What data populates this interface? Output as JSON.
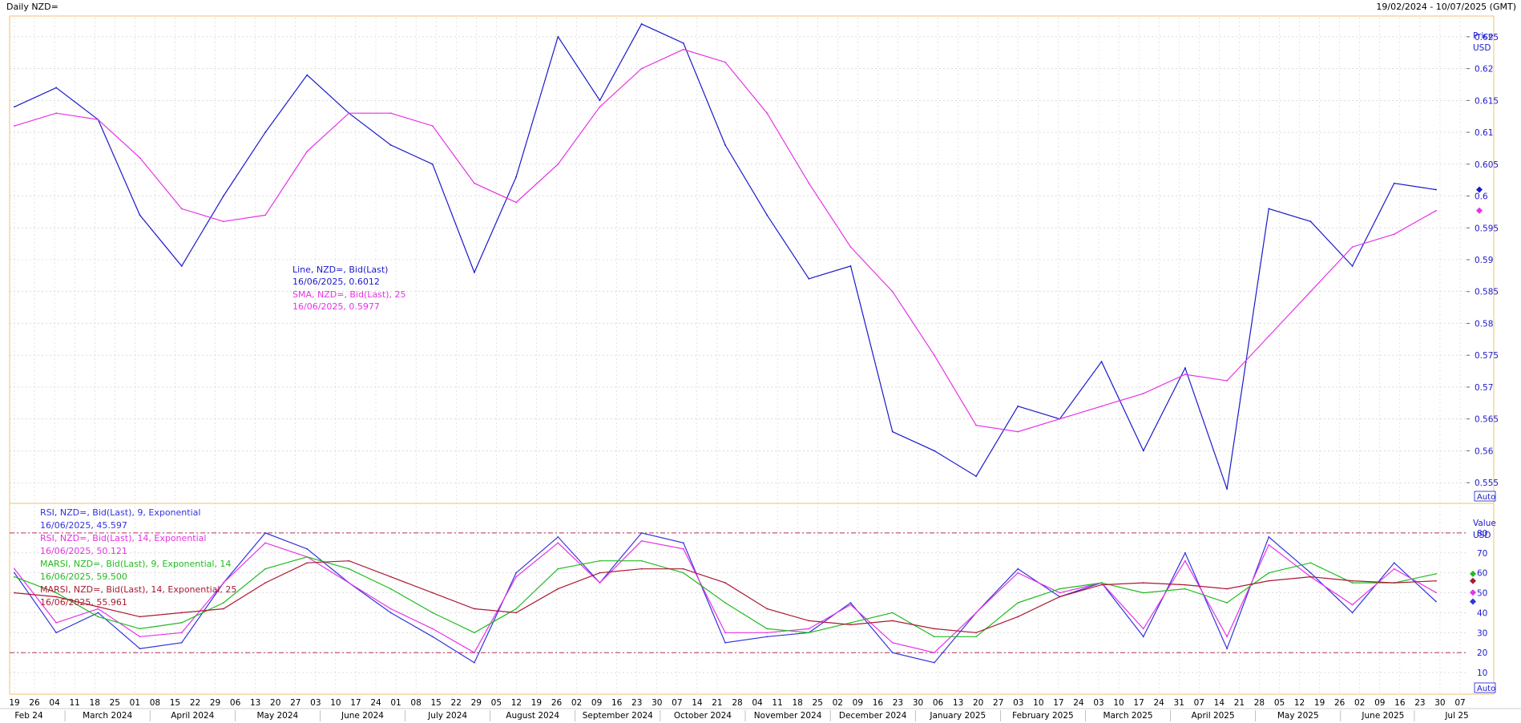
{
  "window": {
    "title": "Daily NZD=",
    "date_range": "19/02/2024 - 10/07/2025 (GMT)"
  },
  "price_panel": {
    "axis_title": "Price",
    "axis_unit": "USD",
    "auto_label": "Auto",
    "ticks": [
      "0.625",
      "0.62",
      "0.615",
      "0.61",
      "0.605",
      "0.6",
      "0.595",
      "0.59",
      "0.585",
      "0.58",
      "0.575",
      "0.57",
      "0.565",
      "0.56",
      "0.555"
    ],
    "legend": {
      "line_label": "Line, NZD=, Bid(Last)",
      "line_value": "16/06/2025, 0.6012",
      "sma_label": "SMA, NZD=, Bid(Last), 25",
      "sma_value": "16/06/2025, 0.5977"
    }
  },
  "osc_panel": {
    "axis_title": "Value",
    "axis_unit": "USD",
    "auto_label": "Auto",
    "ticks": [
      "80",
      "70",
      "60",
      "50",
      "40",
      "30",
      "20",
      "10"
    ],
    "legend": {
      "rsi9_label": "RSI, NZD=, Bid(Last), 9, Exponential",
      "rsi9_value": "16/06/2025, 45.597",
      "rsi14_label": "RSI, NZD=, Bid(Last), 14, Exponential",
      "rsi14_value": "16/06/2025, 50.121",
      "marsi9_label": "MARSI, NZD=, Bid(Last), 9, Exponential, 14",
      "marsi9_value": "16/06/2025, 59.500",
      "marsi14_label": "MARSI, NZD=, Bid(Last), 14, Exponential, 25",
      "marsi14_value": "16/06/2025, 55.961"
    }
  },
  "x_axis": {
    "day_ticks": [
      "19",
      "26",
      "04",
      "11",
      "18",
      "25",
      "01",
      "08",
      "15",
      "22",
      "29",
      "06",
      "13",
      "20",
      "27",
      "03",
      "10",
      "17",
      "24",
      "01",
      "08",
      "15",
      "22",
      "29",
      "05",
      "12",
      "19",
      "26",
      "02",
      "09",
      "16",
      "23",
      "30",
      "07",
      "14",
      "21",
      "28",
      "04",
      "11",
      "18",
      "25",
      "02",
      "09",
      "16",
      "23",
      "30",
      "06",
      "13",
      "20",
      "27",
      "03",
      "10",
      "17",
      "24",
      "03",
      "10",
      "17",
      "24",
      "31",
      "07",
      "14",
      "21",
      "28",
      "05",
      "12",
      "19",
      "26",
      "02",
      "09",
      "16",
      "23",
      "30",
      "07"
    ],
    "month_labels": [
      "Feb 24",
      "March 2024",
      "April 2024",
      "May 2024",
      "June 2024",
      "July 2024",
      "August 2024",
      "September 2024",
      "October 2024",
      "November 2024",
      "December 2024",
      "January 2025",
      "February 2025",
      "March 2025",
      "April 2025",
      "May 2025",
      "June 2025",
      "Jul 25"
    ]
  },
  "colors": {
    "price_line": "#1a1acc",
    "sma_line": "#e633e6",
    "rsi9": "#3333dd",
    "rsi14": "#e633e6",
    "marsi9": "#22bb22",
    "marsi14": "#aa1a33",
    "ob_os_line": "#b0305a",
    "panel_border": "#f0c070",
    "grid": "#c8c8c8"
  },
  "chart_data": [
    {
      "type": "line",
      "title": "Daily NZD=",
      "xlabel": "",
      "ylabel": "Price USD",
      "ylim": [
        0.552,
        0.628
      ],
      "x": [
        "2024-02-19",
        "2024-03-04",
        "2024-03-18",
        "2024-04-01",
        "2024-04-15",
        "2024-05-01",
        "2024-05-13",
        "2024-06-01",
        "2024-06-17",
        "2024-07-01",
        "2024-07-15",
        "2024-07-29",
        "2024-08-12",
        "2024-08-26",
        "2024-09-09",
        "2024-09-23",
        "2024-09-30",
        "2024-10-14",
        "2024-10-28",
        "2024-11-11",
        "2024-11-25",
        "2024-12-09",
        "2024-12-23",
        "2025-01-13",
        "2025-01-27",
        "2025-02-10",
        "2025-02-24",
        "2025-03-10",
        "2025-03-24",
        "2025-04-07",
        "2025-04-21",
        "2025-05-05",
        "2025-05-19",
        "2025-06-02",
        "2025-06-16"
      ],
      "series": [
        {
          "name": "Line, NZD=, Bid(Last)",
          "values": [
            0.614,
            0.617,
            0.612,
            0.597,
            0.589,
            0.6,
            0.61,
            0.619,
            0.613,
            0.608,
            0.605,
            0.588,
            0.603,
            0.625,
            0.615,
            0.627,
            0.624,
            0.608,
            0.597,
            0.587,
            0.589,
            0.563,
            0.56,
            0.556,
            0.567,
            0.565,
            0.574,
            0.56,
            0.573,
            0.554,
            0.598,
            0.596,
            0.589,
            0.602,
            0.601
          ]
        },
        {
          "name": "SMA, NZD=, Bid(Last), 25",
          "values": [
            0.611,
            0.613,
            0.612,
            0.606,
            0.598,
            0.596,
            0.597,
            0.607,
            0.613,
            0.613,
            0.611,
            0.602,
            0.599,
            0.605,
            0.614,
            0.62,
            0.623,
            0.621,
            0.613,
            0.602,
            0.592,
            0.585,
            0.575,
            0.564,
            0.563,
            0.565,
            0.567,
            0.569,
            0.572,
            0.571,
            0.578,
            0.585,
            0.592,
            0.594,
            0.5977
          ]
        }
      ]
    },
    {
      "type": "line",
      "title": "",
      "xlabel": "",
      "ylabel": "Value USD",
      "ylim": [
        0,
        90
      ],
      "reference_lines": [
        80,
        20
      ],
      "x": [
        "2024-02-19",
        "2024-03-04",
        "2024-03-18",
        "2024-04-01",
        "2024-04-15",
        "2024-05-01",
        "2024-05-13",
        "2024-06-01",
        "2024-06-17",
        "2024-07-01",
        "2024-07-15",
        "2024-07-29",
        "2024-08-12",
        "2024-08-26",
        "2024-09-09",
        "2024-09-23",
        "2024-09-30",
        "2024-10-14",
        "2024-10-28",
        "2024-11-11",
        "2024-11-25",
        "2024-12-09",
        "2024-12-23",
        "2025-01-13",
        "2025-01-27",
        "2025-02-10",
        "2025-02-24",
        "2025-03-10",
        "2025-03-24",
        "2025-04-07",
        "2025-04-21",
        "2025-05-05",
        "2025-05-19",
        "2025-06-02",
        "2025-06-16"
      ],
      "series": [
        {
          "name": "RSI, NZD=, Bid(Last), 9, Exponential",
          "values": [
            60,
            30,
            40,
            22,
            25,
            55,
            80,
            72,
            55,
            40,
            28,
            15,
            60,
            78,
            55,
            80,
            75,
            25,
            28,
            30,
            45,
            20,
            15,
            40,
            62,
            48,
            55,
            28,
            70,
            22,
            78,
            60,
            40,
            65,
            45.6
          ]
        },
        {
          "name": "RSI, NZD=, Bid(Last), 14, Exponential",
          "values": [
            62,
            35,
            42,
            28,
            30,
            55,
            75,
            68,
            55,
            42,
            32,
            20,
            58,
            75,
            55,
            76,
            72,
            30,
            30,
            32,
            44,
            25,
            20,
            40,
            60,
            50,
            55,
            32,
            66,
            28,
            74,
            58,
            44,
            62,
            50.1
          ]
        },
        {
          "name": "MARSI, NZD=, Bid(Last), 9, Exponential, 14",
          "values": [
            58,
            50,
            38,
            32,
            35,
            45,
            62,
            68,
            62,
            52,
            40,
            30,
            42,
            62,
            66,
            66,
            60,
            45,
            32,
            30,
            35,
            40,
            28,
            28,
            45,
            52,
            55,
            50,
            52,
            45,
            60,
            65,
            55,
            55,
            59.5
          ]
        },
        {
          "name": "MARSI, NZD=, Bid(Last), 14, Exponential, 25",
          "values": [
            50,
            48,
            43,
            38,
            40,
            42,
            55,
            65,
            66,
            58,
            50,
            42,
            40,
            52,
            60,
            62,
            62,
            55,
            42,
            36,
            34,
            36,
            32,
            30,
            38,
            48,
            54,
            55,
            54,
            52,
            56,
            58,
            56,
            55,
            55.96
          ]
        }
      ]
    }
  ]
}
